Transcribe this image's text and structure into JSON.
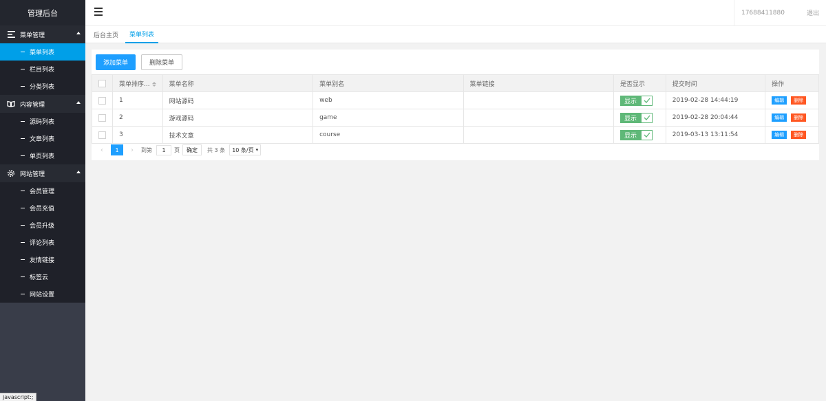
{
  "brand": "管理后台",
  "header": {
    "phone": "17688411880",
    "logout": "退出"
  },
  "sidebar": {
    "groups": [
      {
        "label": "菜单管理",
        "items": [
          "菜单列表",
          "栏目列表",
          "分类列表"
        ]
      },
      {
        "label": "内容管理",
        "items": [
          "源码列表",
          "文章列表",
          "单页列表"
        ]
      },
      {
        "label": "网站管理",
        "items": [
          "会员管理",
          "会员充值",
          "会员升级",
          "评论列表",
          "友情链接",
          "标签云",
          "网站设置"
        ]
      }
    ]
  },
  "tabs": [
    "后台主页",
    "菜单列表"
  ],
  "toolbar": {
    "add": "添加菜单",
    "delete": "删除菜单"
  },
  "table": {
    "headers": [
      "菜单排序...",
      "菜单名称",
      "菜单别名",
      "菜单链接",
      "是否显示",
      "提交时间",
      "操作"
    ],
    "rows": [
      {
        "sort": "1",
        "name": "网站源码",
        "alias": "web",
        "link": "",
        "show": "显示",
        "time": "2019-02-28 14:44:19"
      },
      {
        "sort": "2",
        "name": "游戏源码",
        "alias": "game",
        "link": "",
        "show": "显示",
        "time": "2019-02-28 20:04:44"
      },
      {
        "sort": "3",
        "name": "技术文章",
        "alias": "course",
        "link": "",
        "show": "显示",
        "time": "2019-03-13 13:11:54"
      }
    ],
    "edit": "编辑",
    "del": "删除"
  },
  "pager": {
    "current": "1",
    "goto_label": "到第",
    "goto_value": "1",
    "page_unit": "页",
    "confirm": "确定",
    "total": "共 3 条",
    "page_size": "10 条/页"
  },
  "status_url": "javascript:;",
  "colors": {
    "accent": "#009fe8",
    "primary": "#1e9fff",
    "success": "#5fb878",
    "danger": "#ff5722",
    "sidebar": "#393d49"
  }
}
